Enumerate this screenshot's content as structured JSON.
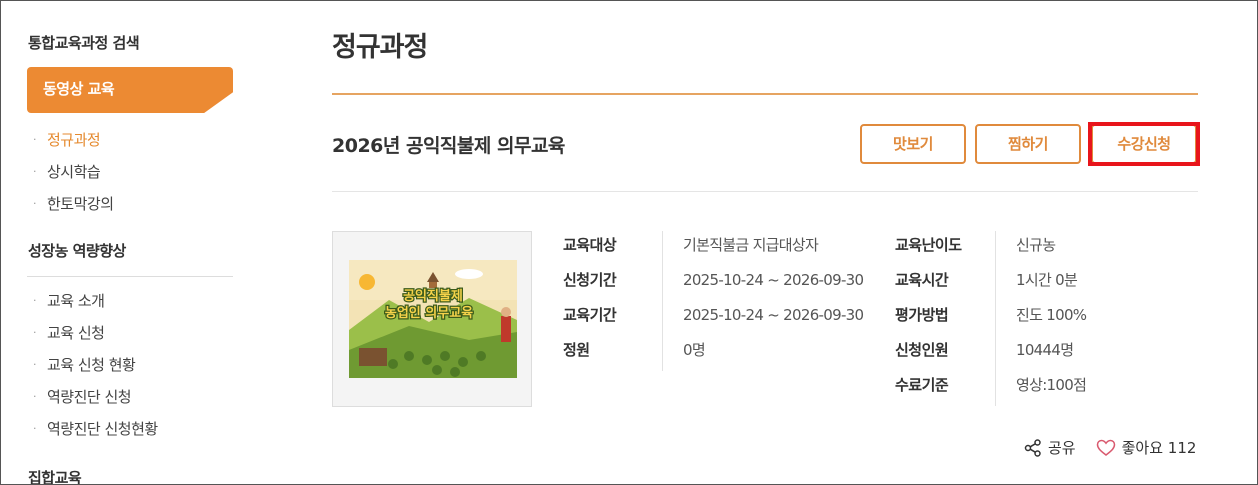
{
  "sidebar": {
    "section1_title": "통합교육과정 검색",
    "active_menu": "동영상 교육",
    "sub_items": [
      "정규과정",
      "상시학습",
      "한토막강의"
    ],
    "section2_title": "성장농 역량향상",
    "section2_items": [
      "교육 소개",
      "교육 신청",
      "교육 신청 현황",
      "역량진단 신청",
      "역량진단 신청현황"
    ],
    "section3_title": "집합교육"
  },
  "main": {
    "page_title": "정규과정",
    "course_title": "2026년 공익직불제 의무교육",
    "buttons": {
      "preview": "맛보기",
      "wish": "찜하기",
      "apply": "수강신청"
    },
    "thumbnail_text_line1": "공익직불제",
    "thumbnail_text_line2": "농업인 의무교육",
    "info_left": {
      "labels": [
        "교육대상",
        "신청기간",
        "교육기간",
        "정원"
      ],
      "values": [
        "기본직불금 지급대상자",
        "2025-10-24 ~ 2026-09-30",
        "2025-10-24 ~ 2026-09-30",
        "0명"
      ]
    },
    "info_right": {
      "labels": [
        "교육난이도",
        "교육시간",
        "평가방법",
        "신청인원",
        "수료기준"
      ],
      "values": [
        "신규농",
        "1시간 0분",
        "진도 100%",
        "10444명",
        "영상:100점"
      ]
    },
    "share_label": "공유",
    "like_label": "좋아요 112"
  },
  "colors": {
    "accent": "#ec8a33",
    "highlight": "#e8151b"
  }
}
